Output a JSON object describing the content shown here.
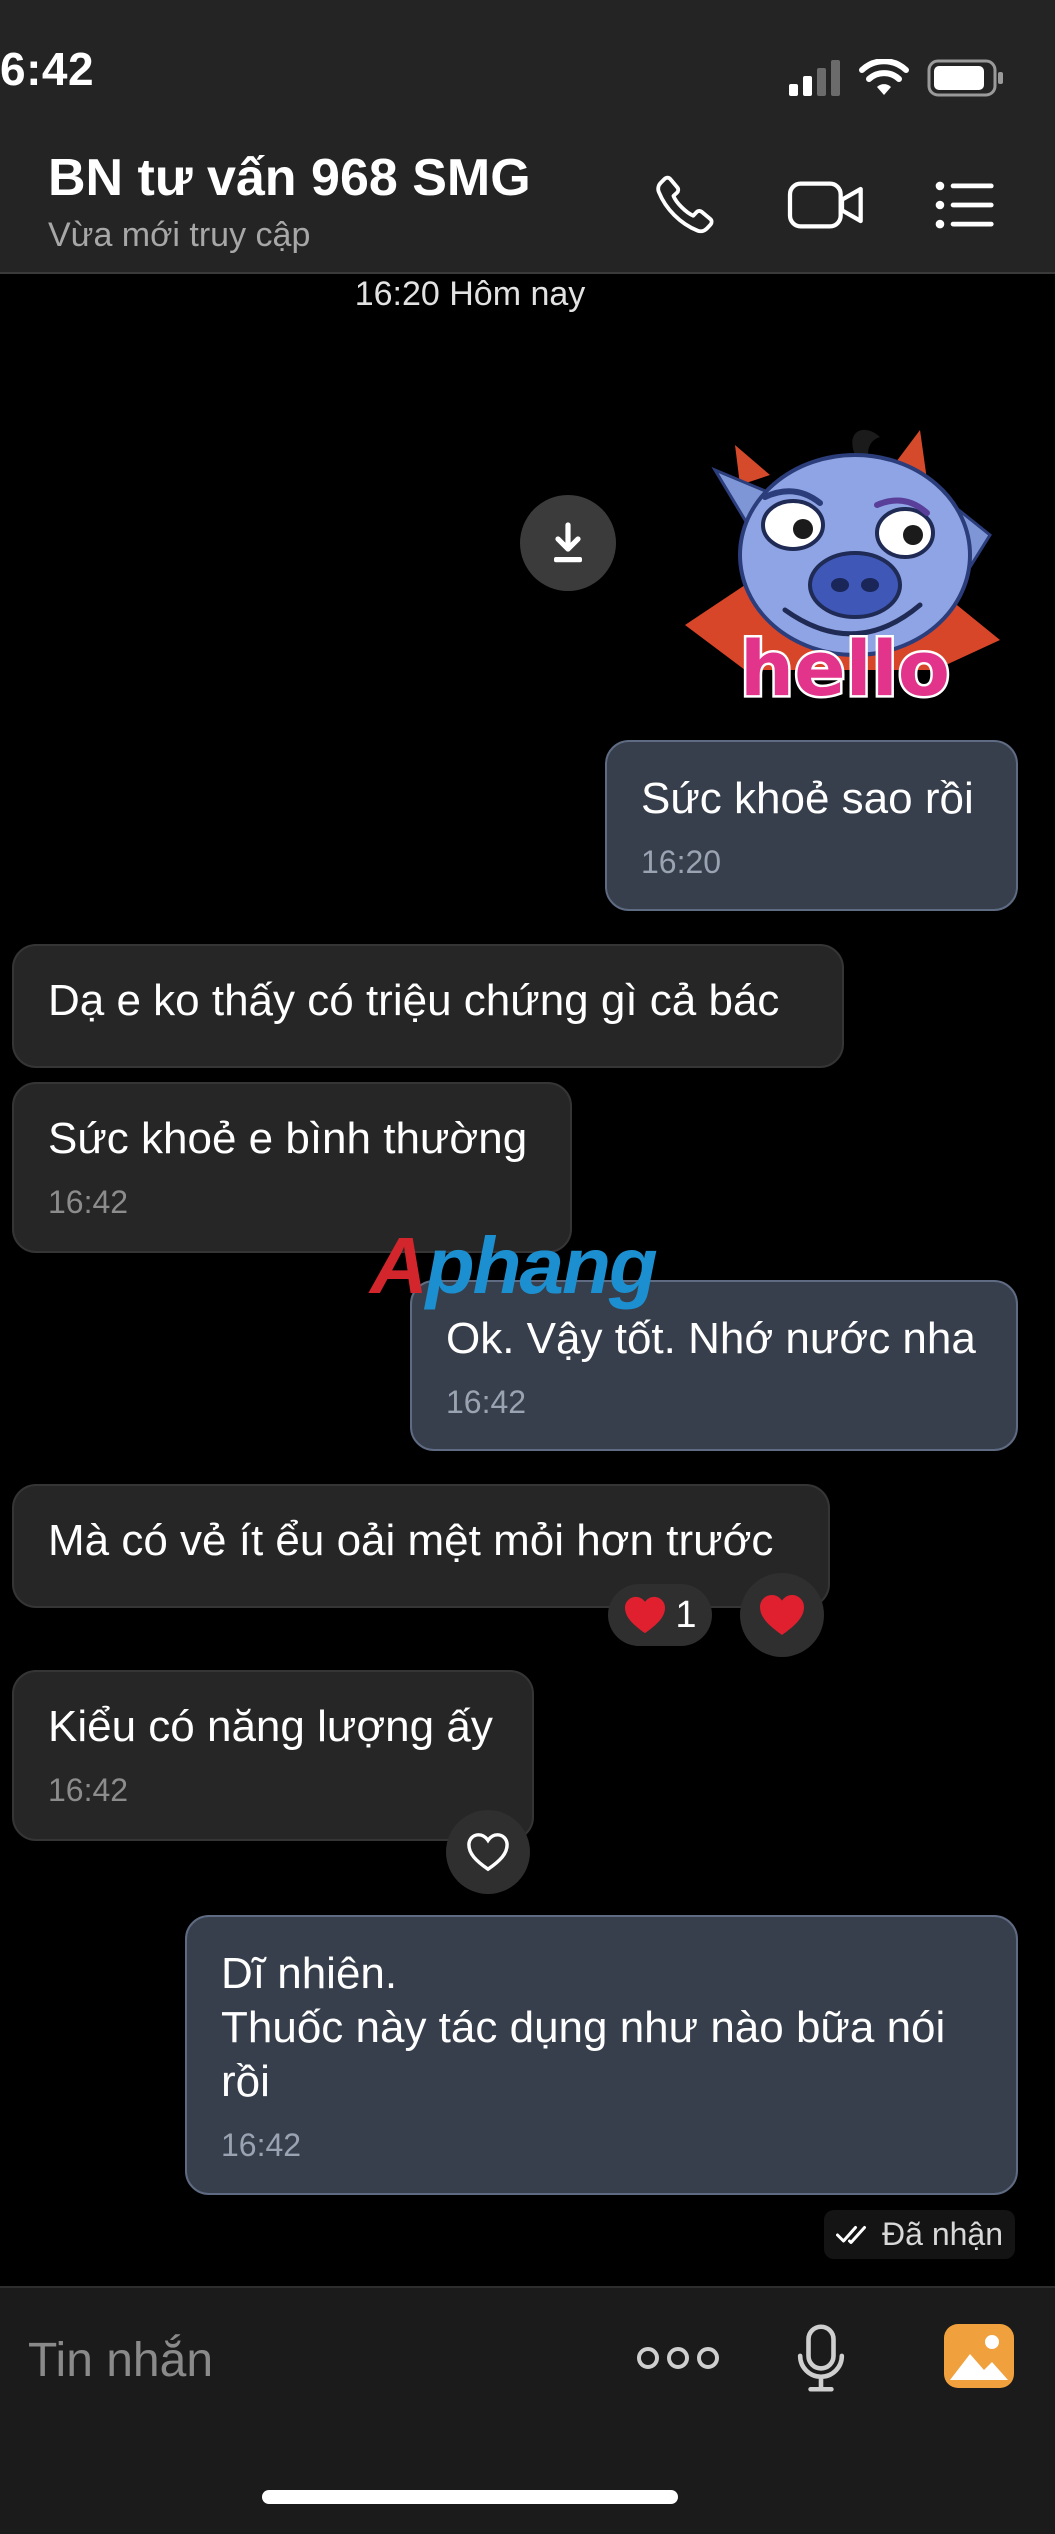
{
  "status_bar": {
    "time": "6:42"
  },
  "header": {
    "title": "BN tư vấn 968 SMG",
    "subtitle": "Vừa mới truy cập"
  },
  "date_separator": "16:20 Hôm nay",
  "sticker": {
    "text": "hello"
  },
  "messages": [
    {
      "id": "m1",
      "direction": "out",
      "text": "Sức khoẻ sao rồi",
      "time": "16:20"
    },
    {
      "id": "m2",
      "direction": "in",
      "text": "Dạ e ko thấy có triệu chứng gì cả bác"
    },
    {
      "id": "m3",
      "direction": "in",
      "text": "Sức khoẻ e bình thường",
      "time": "16:42"
    },
    {
      "id": "m4",
      "direction": "out",
      "text": "Ok. Vậy tốt. Nhớ nước nha",
      "time": "16:42"
    },
    {
      "id": "m5",
      "direction": "in",
      "text": "Mà có vẻ ít ểu oải mệt mỏi hơn trước",
      "reaction_count": "1"
    },
    {
      "id": "m6",
      "direction": "in",
      "text": "Kiểu có năng lượng ấy",
      "time": "16:42"
    },
    {
      "id": "m7",
      "direction": "out",
      "text": "Dĩ nhiên.\nThuốc này tác dụng như nào bữa nói rồi",
      "time": "16:42"
    }
  ],
  "delivery_status": "Đã nhận",
  "watermark": "Aphang",
  "input": {
    "placeholder": "Tin nhắn"
  },
  "colors": {
    "out_bubble": "#373f4c",
    "in_bubble": "#262626",
    "reaction_heart": "#e0202e",
    "gallery_icon": "#f0a03c"
  }
}
